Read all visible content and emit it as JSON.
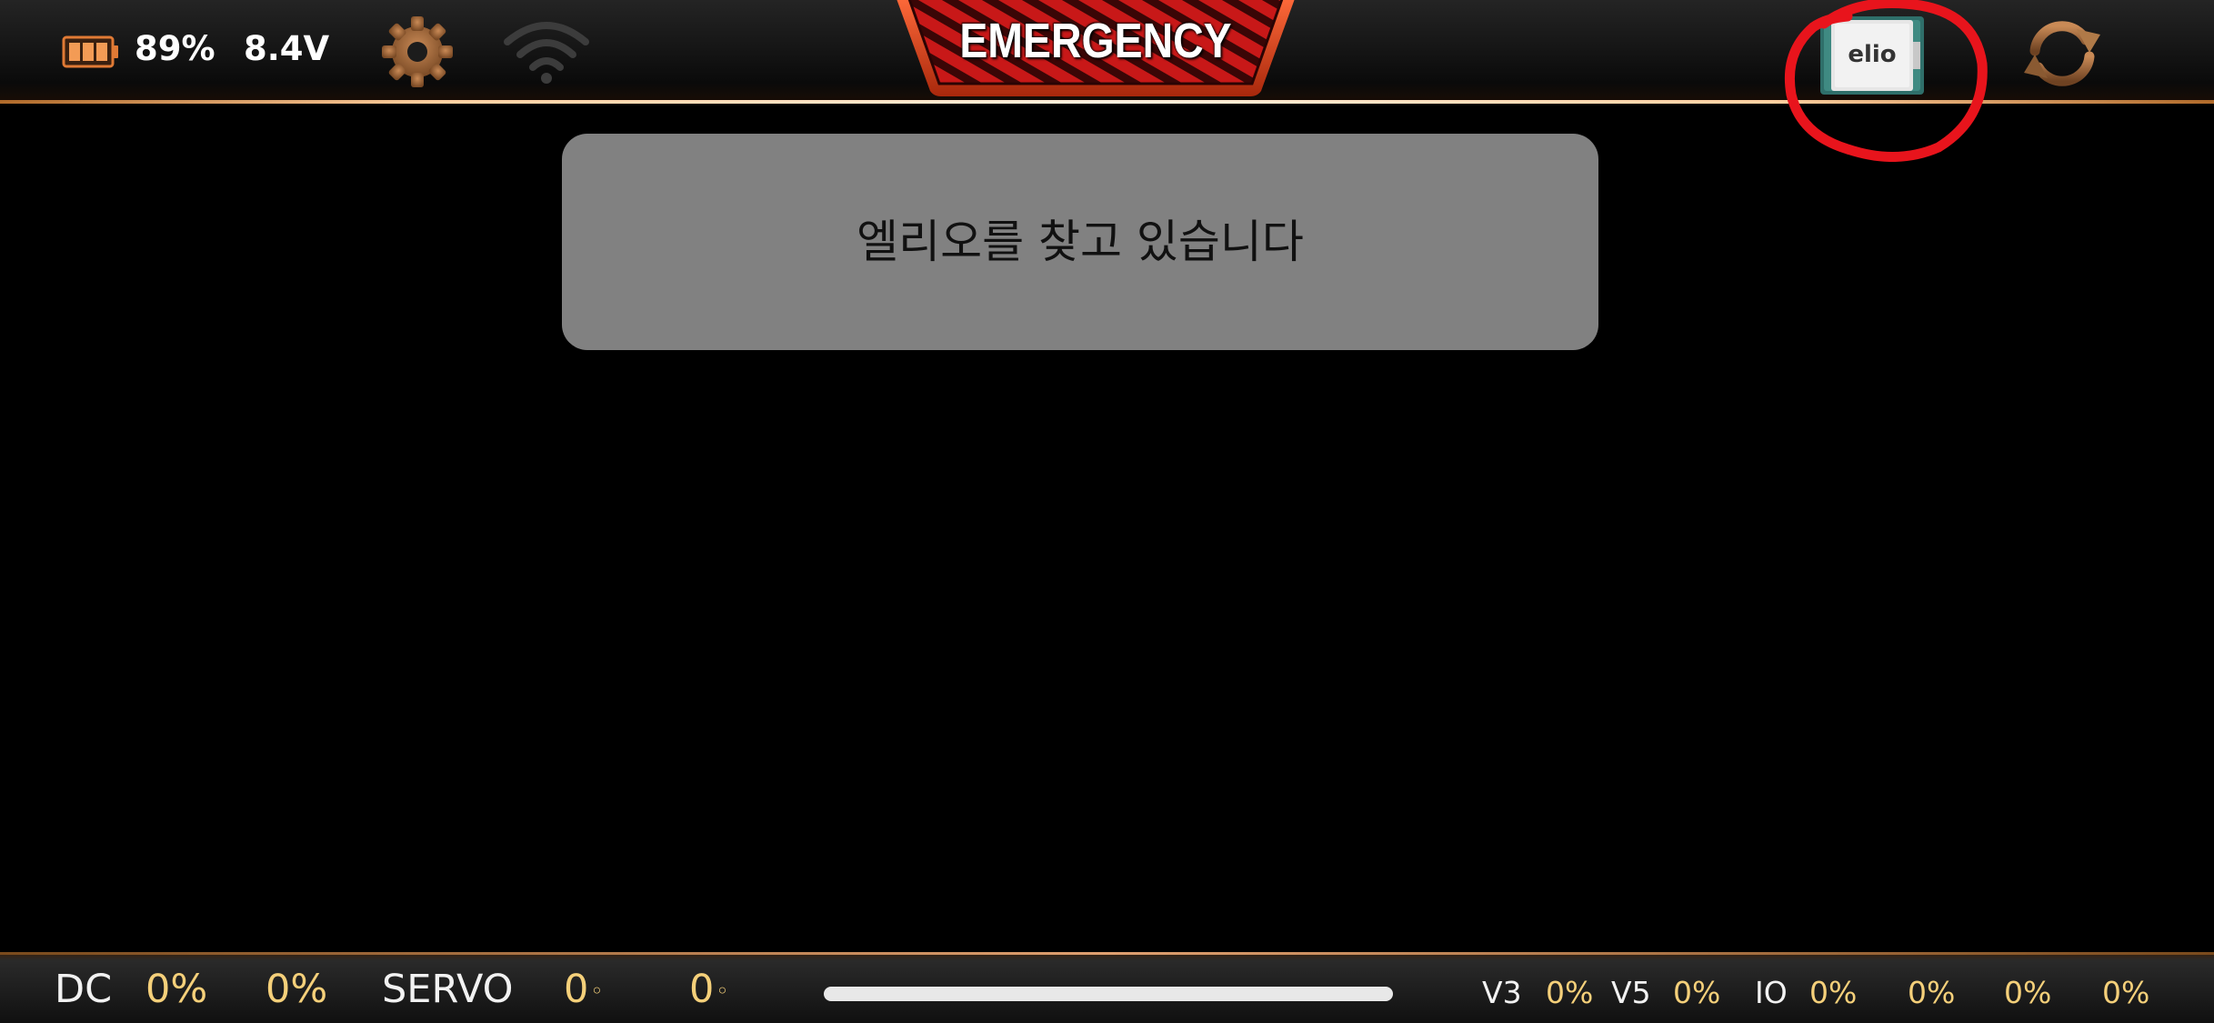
{
  "status": {
    "battery_percent": "89%",
    "voltage": "8.4V"
  },
  "header": {
    "emergency_label": "EMERGENCY",
    "device_label": "elio"
  },
  "toast": {
    "message": "엘리오를 찾고 있습니다"
  },
  "footer": {
    "dc_label": "DC",
    "dc_values": [
      "0%",
      "0%"
    ],
    "servo_label": "SERVO",
    "servo_values": [
      "0",
      "0"
    ],
    "servo_unit": "◦",
    "v3_label": "V3",
    "v3_value": "0%",
    "v5_label": "V5",
    "v5_value": "0%",
    "io_label": "IO",
    "io_values": [
      "0%",
      "0%",
      "0%",
      "0%"
    ]
  },
  "colors": {
    "accent_orange": "#e07a35",
    "value_yellow": "#f5d07a",
    "annotation_red": "#e8141c",
    "toast_bg": "#818181"
  },
  "icons": [
    "battery-icon",
    "gear-icon",
    "wifi-icon",
    "chip-icon",
    "refresh-icon"
  ]
}
